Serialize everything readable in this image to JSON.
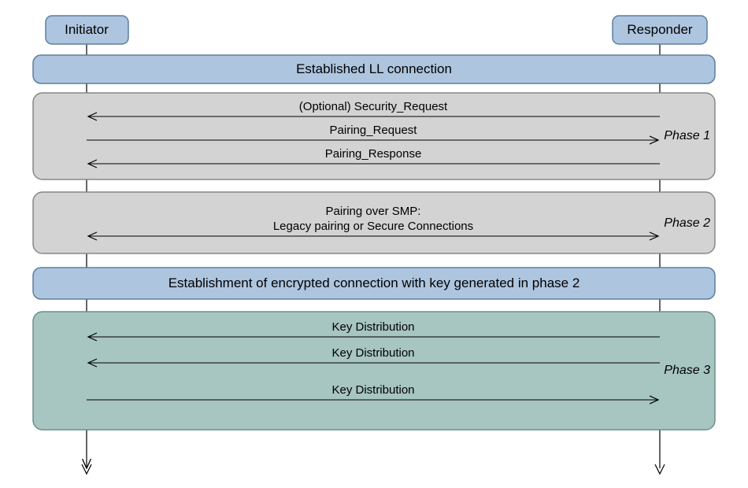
{
  "actors": {
    "initiator": "Initiator",
    "responder": "Responder"
  },
  "banners": {
    "ll_connection": "Established LL connection",
    "encrypted_connection": "Establishment of encrypted connection with key generated in phase 2"
  },
  "phase1": {
    "label": "Phase 1",
    "msg1": "(Optional) Security_Request",
    "msg2": "Pairing_Request",
    "msg3": "Pairing_Response"
  },
  "phase2": {
    "label": "Phase 2",
    "line1": "Pairing over SMP:",
    "line2": "Legacy pairing or Secure Connections"
  },
  "phase3": {
    "label": "Phase 3",
    "msg1": "Key Distribution",
    "msg2": "Key Distribution",
    "msg3": "Key Distribution"
  },
  "colors": {
    "blue_fill": "#aec5df",
    "blue_stroke": "#5d7ea0",
    "grey_fill": "#d3d3d3",
    "grey_stroke": "#888888",
    "teal_fill": "#a7c5c1",
    "teal_stroke": "#6d8f8a",
    "line": "#000000"
  }
}
